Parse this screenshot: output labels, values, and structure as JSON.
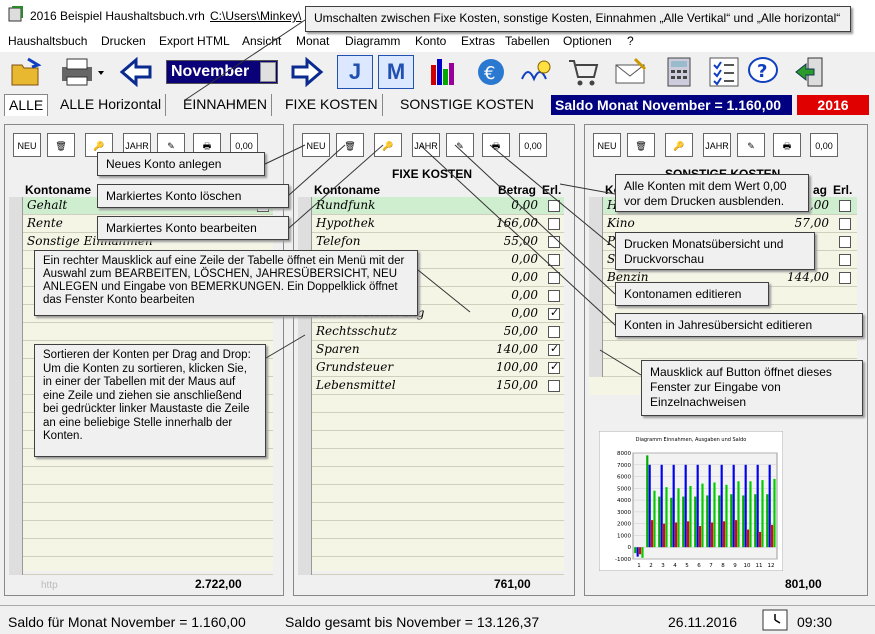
{
  "window": {
    "title": "2016 Beispiel Haushaltsbuch.vrh",
    "path": "C:\\Users\\Minkey\\"
  },
  "menu": [
    "Haushaltsbuch",
    "Drucken",
    "Export HTML",
    "Ansicht",
    "Monat",
    "Diagramm",
    "Konto",
    "Extras",
    "Tabellen",
    "Optionen",
    "?"
  ],
  "toolbar": {
    "month": "November",
    "j_label": "J",
    "m_label": "M"
  },
  "tabs": [
    "ALLE",
    "ALLE Horizontal",
    "EINNAHMEN",
    "FIXE KOSTEN",
    "SONSTIGE KOSTEN"
  ],
  "saldo_month": "Saldo Monat November = 1.160,00",
  "year": "2016",
  "panel_tools": {
    "neu": "NEU",
    "jahr": "JAHR",
    "zero": "0,00"
  },
  "left_panel": {
    "hdr_name": "Kontoname",
    "rows": [
      {
        "name": "Gehalt"
      },
      {
        "name": "Rente"
      },
      {
        "name": "Sonstige Einnahmen"
      }
    ],
    "total": "2.722,00",
    "footer_hint": "http"
  },
  "mid_panel": {
    "title": "FIXE KOSTEN",
    "hdr_name": "Kontoname",
    "hdr_amount": "Betrag",
    "hdr_done": "Erl.",
    "rows": [
      {
        "name": "Rundfunk",
        "amount": "0,00",
        "done": false
      },
      {
        "name": "Hypothek",
        "amount": "166,00",
        "done": false
      },
      {
        "name": "Telefon",
        "amount": "55,00",
        "done": false
      },
      {
        "name": "",
        "amount": "0,00",
        "done": false
      },
      {
        "name": "",
        "amount": "0,00",
        "done": false
      },
      {
        "name": "",
        "amount": "0,00",
        "done": false
      },
      {
        "name": "Autoversicherung",
        "amount": "0,00",
        "done": true
      },
      {
        "name": "Rechtsschutz",
        "amount": "50,00",
        "done": false
      },
      {
        "name": "Sparen",
        "amount": "140,00",
        "done": true
      },
      {
        "name": "Grundsteuer",
        "amount": "100,00",
        "done": true
      },
      {
        "name": "Lebensmittel",
        "amount": "150,00",
        "done": false
      }
    ],
    "total": "761,00"
  },
  "right_panel": {
    "title": "SONSTIGE KOSTEN",
    "hdr_name": "Ko",
    "hdr_amount": "ag",
    "hdr_done": "Erl.",
    "rows": [
      {
        "name": "H",
        "amount": "0,00"
      },
      {
        "name": "Kino",
        "amount": "57,00"
      },
      {
        "name": "P",
        "amount": ""
      },
      {
        "name": "So",
        "amount": ""
      },
      {
        "name": "Benzin",
        "amount": "144,00"
      }
    ],
    "total": "801,00"
  },
  "chart_data": {
    "type": "bar",
    "title": "Diagramm Einnahmen, Ausgaben und Saldo",
    "categories": [
      "1",
      "2",
      "3",
      "4",
      "5",
      "6",
      "7",
      "8",
      "9",
      "10",
      "11",
      "12"
    ],
    "ylim": [
      -1000,
      8000
    ],
    "yticks": [
      "8000",
      "7000",
      "6000",
      "5000",
      "4000",
      "3000",
      "2000",
      "1000",
      "0",
      "-1000"
    ],
    "series": [
      {
        "values": [
          -500,
          7800,
          4300,
          4200,
          4300,
          4300,
          4400,
          4400,
          4500,
          4400,
          4500,
          4500
        ],
        "color": "#00aa00"
      },
      {
        "values": [
          -800,
          7000,
          7000,
          7000,
          7000,
          7000,
          7000,
          7000,
          7000,
          7000,
          7000,
          7000
        ],
        "color": "#0000ee"
      },
      {
        "values": [
          -600,
          2300,
          2000,
          2100,
          2200,
          1800,
          2100,
          2200,
          2300,
          1500,
          1300,
          1900
        ],
        "color": "#ee0000"
      },
      {
        "values": [
          -900,
          4800,
          5100,
          5000,
          5200,
          5400,
          5500,
          5300,
          5600,
          5600,
          5700,
          5800
        ],
        "color": "#00cc00"
      }
    ]
  },
  "callouts": {
    "c1": "Umschalten zwischen Fixe Kosten, sonstige Kosten, Einnahmen „Alle Vertikal“ und „Alle horizontal“",
    "c2": "Neues Konto anlegen",
    "c3": "Markiertes Konto löschen",
    "c4": "Markiertes Konto bearbeiten",
    "c5": "Ein rechter Mausklick auf eine Zeile der Tabelle öffnet ein Menü mit der Auswahl zum BEARBEITEN, LÖSCHEN, JAHRESÜBERSICHT, NEU ANLEGEN und Eingabe von BEMERKUNGEN. Ein Doppelklick öffnet das Fenster Konto bearbeiten",
    "c6": "Sortieren der Konten per Drag and Drop: Um die Konten zu sortieren, klicken Sie, in einer der Tabellen mit der Maus auf eine Zeile und ziehen sie anschließend bei gedrückter linker Maustaste die Zeile an eine beliebige Stelle innerhalb der Konten.",
    "c7": "Alle Konten mit dem Wert 0,00 vor dem Drucken ausblenden.",
    "c8": "Drucken Monatsübersicht und Druckvorschau",
    "c9": "Kontonamen editieren",
    "c10": "Konten in Jahresübersicht editieren",
    "c11": "Mausklick auf Button öffnet dieses Fenster zur Eingabe von Einzelnachweisen"
  },
  "status": {
    "saldo": "Saldo für Monat November = 1.160,00",
    "gesamt": "Saldo gesamt bis November = 13.126,37",
    "date": "26.11.2016",
    "time": "09:30"
  }
}
